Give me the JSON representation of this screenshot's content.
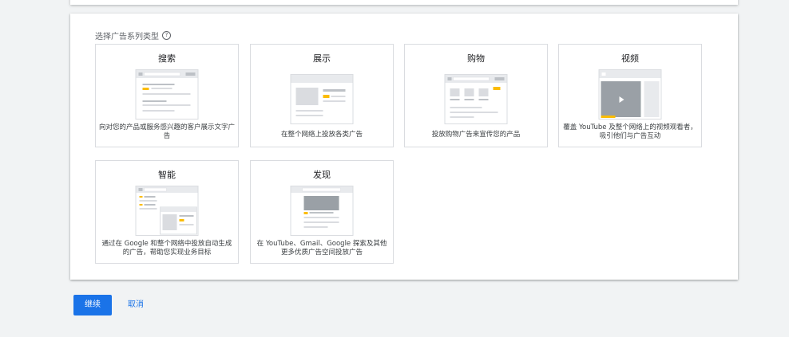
{
  "section": {
    "label": "选择广告系列类型",
    "help_icon": "?"
  },
  "tiles": [
    {
      "title": "搜索",
      "description": "向对您的产品或服务感兴趣的客户展示文字广告",
      "icon": "search-illustration"
    },
    {
      "title": "展示",
      "description": "在整个网络上投放各类广告",
      "icon": "display-illustration"
    },
    {
      "title": "购物",
      "description": "投放购物广告来宣传您的产品",
      "icon": "shopping-illustration"
    },
    {
      "title": "视频",
      "description": "覆盖 YouTube 及整个网络上的视频观看者，吸引他们与广告互动",
      "icon": "video-illustration"
    },
    {
      "title": "智能",
      "description": "通过在 Google 和整个网络中投放自动生成的广告，帮助您实现业务目标",
      "icon": "smart-illustration"
    },
    {
      "title": "发现",
      "description": "在 YouTube、Gmail、Google 探索及其他更多优质广告空间投放广告",
      "icon": "discovery-illustration"
    }
  ],
  "actions": {
    "continue_label": "继续",
    "cancel_label": "取消"
  },
  "colors": {
    "accent": "#1a73e8",
    "highlight": "#fbbc04",
    "background": "#f1f3f4"
  }
}
